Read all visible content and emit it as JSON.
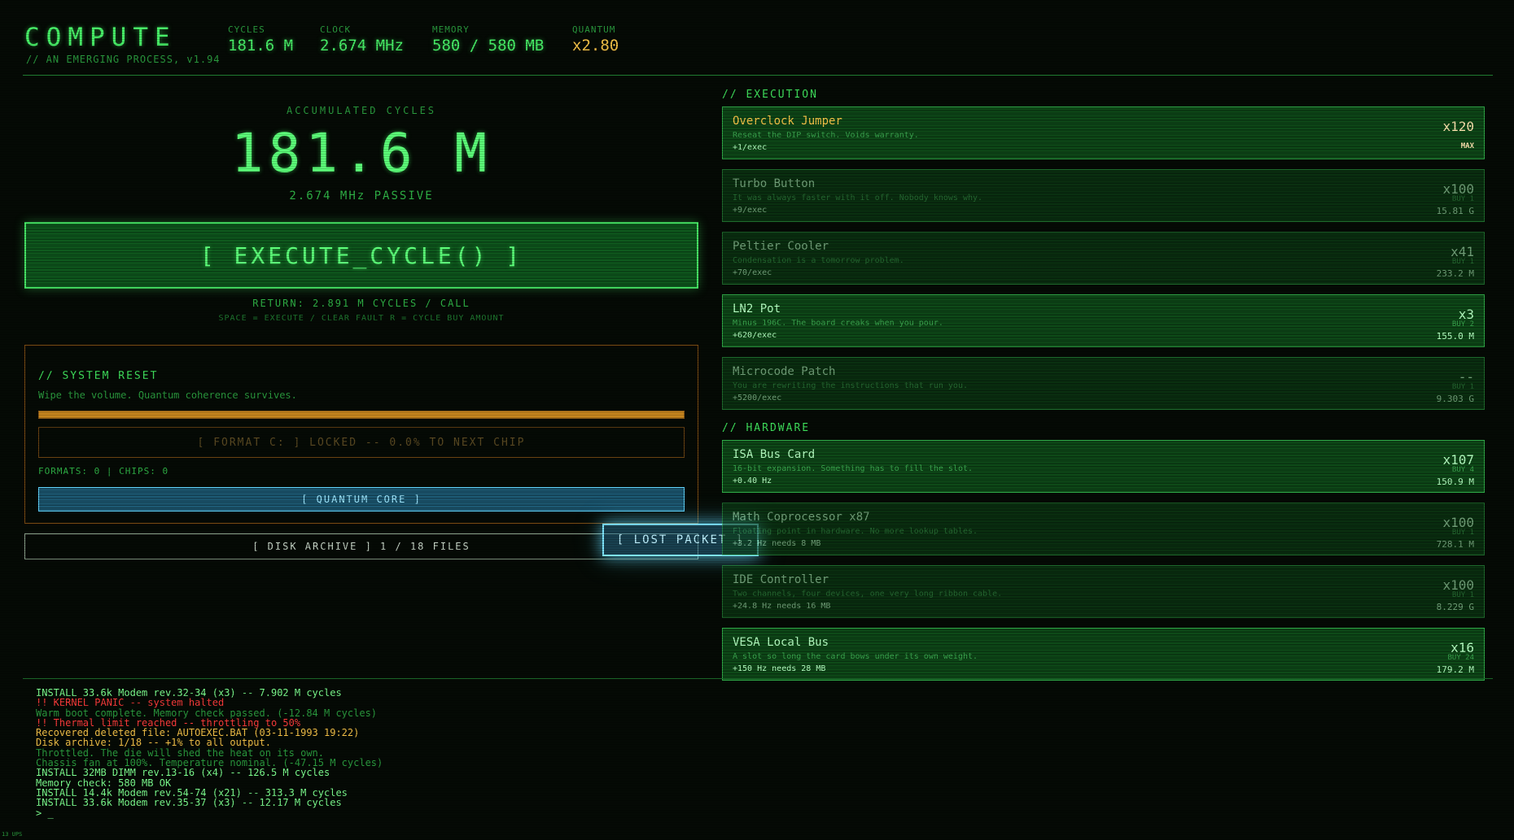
{
  "header": {
    "title": "COMPUTE",
    "subtitle": "// AN EMERGING PROCESS, v1.94",
    "stats": [
      {
        "label": "CYCLES",
        "value": "181.6 M",
        "color": "#48f168"
      },
      {
        "label": "CLOCK",
        "value": "2.674 MHz",
        "color": "#48f168"
      },
      {
        "label": "MEMORY",
        "value": "580 / 580 MB",
        "color": "#48f168"
      },
      {
        "label": "QUANTUM",
        "value": "x2.80",
        "color": "#f7c348"
      }
    ]
  },
  "main": {
    "accumulated_label": "ACCUMULATED CYCLES",
    "accumulated_value": "181.6 M",
    "passive_rate": "2.674 MHz PASSIVE",
    "execute_button": "[ EXECUTE_CYCLE() ]",
    "return_line": "RETURN: 2.891 M CYCLES / CALL",
    "hint_line": "SPACE = EXECUTE / CLEAR FAULT R = CYCLE BUY AMOUNT"
  },
  "system_reset": {
    "title": "// SYSTEM RESET",
    "description": "Wipe the volume. Quantum coherence survives.",
    "progress": 1.0,
    "format_button": "[ FORMAT C: ] LOCKED -- 0.0% TO NEXT CHIP",
    "counts": "FORMATS: 0 | CHIPS: 0",
    "quantum_button": "[ QUANTUM CORE ]"
  },
  "disk_archive_button": "[ DISK ARCHIVE ] 1 / 18 FILES",
  "lost_packet_button": "[ LOST PACKET ]",
  "execution": {
    "title": "// EXECUTION",
    "items": [
      {
        "name": "Overclock Jumper",
        "desc": "Reseat the DIP switch. Voids warranty.",
        "rate": "+1/exec",
        "owned": "x120",
        "buy": "MAX",
        "cost": ""
      },
      {
        "name": "Turbo Button",
        "desc": "It was always faster with it off. Nobody knows why.",
        "rate": "+9/exec",
        "owned": "x100",
        "buy": "BUY 1",
        "cost": "15.81 G"
      },
      {
        "name": "Peltier Cooler",
        "desc": "Condensation is a tomorrow problem.",
        "rate": "+70/exec",
        "owned": "x41",
        "buy": "BUY 1",
        "cost": "233.2 M"
      },
      {
        "name": "LN2 Pot",
        "desc": "Minus 196C. The board creaks when you pour.",
        "rate": "+620/exec",
        "owned": "x3",
        "buy": "BUY 2",
        "cost": "155.0 M"
      },
      {
        "name": "Microcode Patch",
        "desc": "You are rewriting the instructions that run you.",
        "rate": "+5200/exec",
        "owned": "--",
        "buy": "BUY 1",
        "cost": "9.303 G"
      }
    ]
  },
  "hardware": {
    "title": "// HARDWARE",
    "items": [
      {
        "name": "ISA Bus Card",
        "desc": "16-bit expansion. Something has to fill the slot.",
        "rate": "+0.40 Hz",
        "owned": "x107",
        "buy": "BUY 4",
        "cost": "150.9 M"
      },
      {
        "name": "Math Coprocessor x87",
        "desc": "Floating point in hardware. No more lookup tables.",
        "rate": "+3.2 Hz needs 8 MB",
        "owned": "x100",
        "buy": "BUY 1",
        "cost": "728.1 M"
      },
      {
        "name": "IDE Controller",
        "desc": "Two channels, four devices, one very long ribbon cable.",
        "rate": "+24.8 Hz needs 16 MB",
        "owned": "x100",
        "buy": "BUY 1",
        "cost": "8.229 G"
      },
      {
        "name": "VESA Local Bus",
        "desc": "A slot so long the card bows under its own weight.",
        "rate": "+150 Hz needs 28 MB",
        "owned": "x16",
        "buy": "BUY 24",
        "cost": "179.2 M"
      }
    ]
  },
  "log": [
    {
      "text": "INSTALL 33.6k Modem rev.32-34 (x3) -- 7.902 M cycles",
      "color": "green"
    },
    {
      "text": "!! KERNEL PANIC -- system halted",
      "color": "red"
    },
    {
      "text": "Warm boot complete. Memory check passed. (-12.84 M cycles)",
      "color": "dim"
    },
    {
      "text": "!! Thermal limit reached -- throttling to 50%",
      "color": "red"
    },
    {
      "text": "Recovered deleted file: AUTOEXEC.BAT (03-11-1993 19:22)",
      "color": "orange"
    },
    {
      "text": "Disk archive: 1/18 -- +1% to all output.",
      "color": "orange"
    },
    {
      "text": "Throttled. The die will shed the heat on its own.",
      "color": "dim"
    },
    {
      "text": "Chassis fan at 100%. Temperature nominal. (-47.15 M cycles)",
      "color": "dim"
    },
    {
      "text": "INSTALL 32MB DIMM rev.13-16 (x4) -- 126.5 M cycles",
      "color": "green"
    },
    {
      "text": "Memory check: 580 MB OK",
      "color": "green"
    },
    {
      "text": "INSTALL 14.4k Modem rev.54-74 (x21) -- 313.3 M cycles",
      "color": "green"
    },
    {
      "text": "INSTALL 33.6k Modem rev.35-37 (x3) -- 12.17 M cycles",
      "color": "green"
    },
    {
      "text": "> _",
      "color": "green"
    }
  ],
  "fps": "13 UPS"
}
